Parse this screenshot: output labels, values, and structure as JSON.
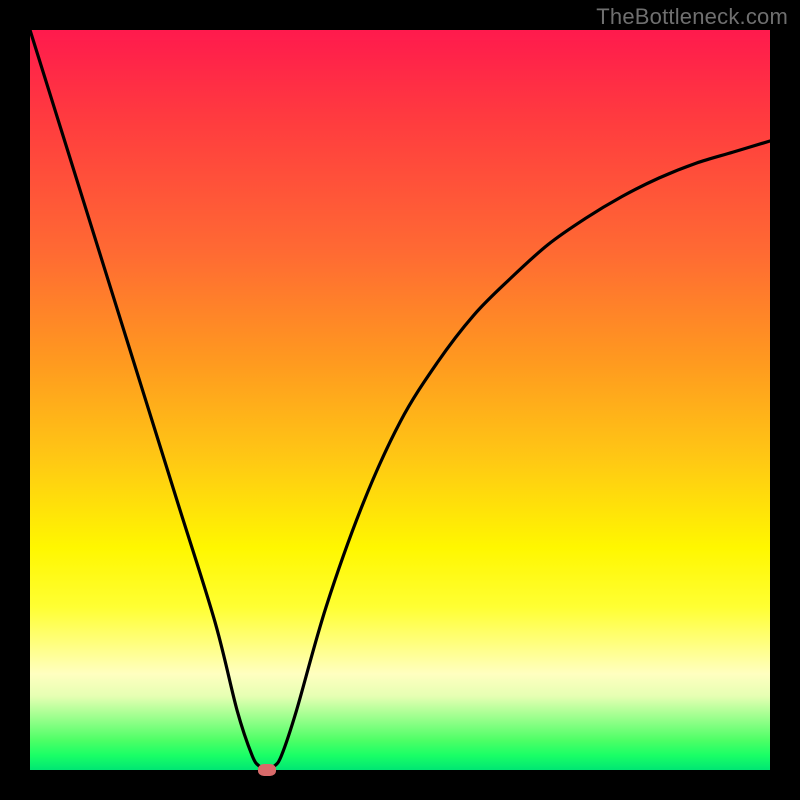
{
  "watermark": "TheBottleneck.com",
  "colors": {
    "background": "#000000",
    "curve_stroke": "#000000",
    "marker_fill": "#d86a6a",
    "watermark_text": "#6f6f6f"
  },
  "chart_data": {
    "type": "line",
    "title": "",
    "xlabel": "",
    "ylabel": "",
    "xlim": [
      0,
      100
    ],
    "ylim": [
      0,
      100
    ],
    "grid": false,
    "series": [
      {
        "name": "bottleneck-curve",
        "x": [
          0,
          5,
          10,
          15,
          20,
          25,
          28,
          30,
          31,
          32,
          33,
          34,
          36,
          40,
          45,
          50,
          55,
          60,
          65,
          70,
          75,
          80,
          85,
          90,
          95,
          100
        ],
        "values": [
          100,
          84,
          68,
          52,
          36,
          20,
          8,
          2,
          0.5,
          0,
          0.5,
          2,
          8,
          22,
          36,
          47,
          55,
          61.5,
          66.5,
          71,
          74.5,
          77.5,
          80,
          82,
          83.5,
          85
        ]
      }
    ],
    "annotations": [
      {
        "name": "optimal-point-marker",
        "x": 32,
        "y": 0
      }
    ]
  }
}
